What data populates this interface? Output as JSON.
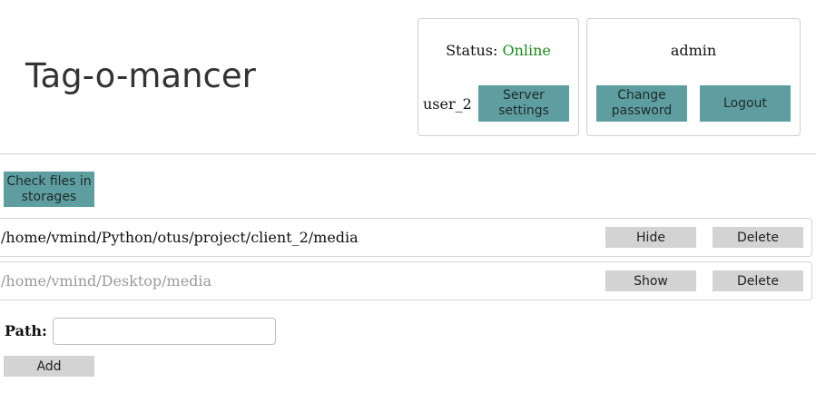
{
  "app": {
    "title": "Tag-o-mancer"
  },
  "status_panel": {
    "status_label": "Status:",
    "status_value": "Online",
    "status_color": "#1e8a1e",
    "client_name": "user_2",
    "server_settings_label": "Server\nsettings"
  },
  "user_panel": {
    "username": "admin",
    "change_password_label": "Change\npassword",
    "logout_label": "Logout"
  },
  "actions": {
    "check_files_label": "Check files in\nstorages"
  },
  "storages": [
    {
      "path": "/home/vmind/Python/otus/project/client_2/media",
      "toggle_label": "Hide",
      "delete_label": "Delete"
    },
    {
      "path": "/home/vmind/Desktop/media",
      "toggle_label": "Show",
      "delete_label": "Delete"
    }
  ],
  "add_form": {
    "path_label": "Path:",
    "path_value": "",
    "add_label": "Add"
  },
  "colors": {
    "accent": "#5f9ea0",
    "secondary_button": "#d3d3d3",
    "border": "#cfcfcf"
  }
}
